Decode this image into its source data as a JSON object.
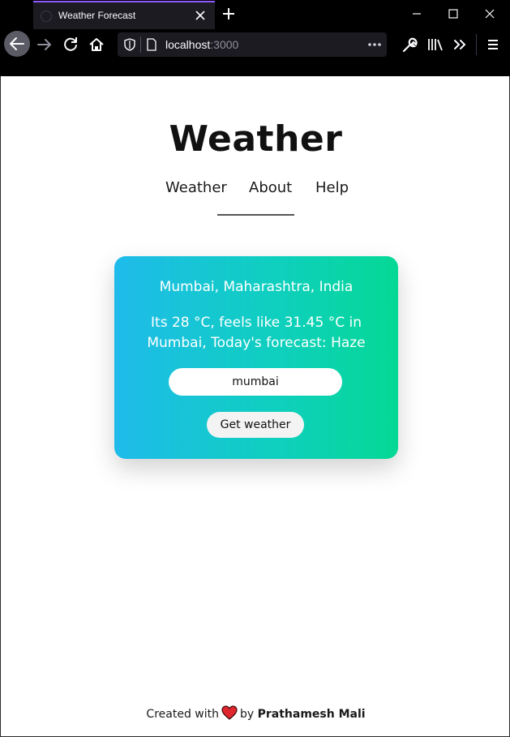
{
  "browser": {
    "tab_title": "Weather Forecast",
    "url_host": "localhost",
    "url_port": ":3000",
    "more_label": "•••"
  },
  "site": {
    "title": "Weather",
    "nav": [
      {
        "label": "Weather"
      },
      {
        "label": "About"
      },
      {
        "label": "Help"
      }
    ]
  },
  "weather_card": {
    "location": "Mumbai, Maharashtra, India",
    "forecast": "Its 28 °C, feels like 31.45 °C in Mumbai, Today's forecast: Haze",
    "search_value": "mumbai",
    "button_label": "Get weather"
  },
  "footer": {
    "prefix": "Created with",
    "by": "by",
    "author": "Prathamesh Mali"
  },
  "colors": {
    "card_gradient_start": "#1fbbeb",
    "card_gradient_end": "#05d895",
    "heart": "#e0262f",
    "tab_accent": "#9059ff"
  },
  "icons": [
    "back-icon",
    "forward-icon",
    "reload-icon",
    "home-icon",
    "shield-icon",
    "page-icon",
    "wrench-icon",
    "library-icon",
    "overflow-icon",
    "menu-icon",
    "heart-icon"
  ]
}
